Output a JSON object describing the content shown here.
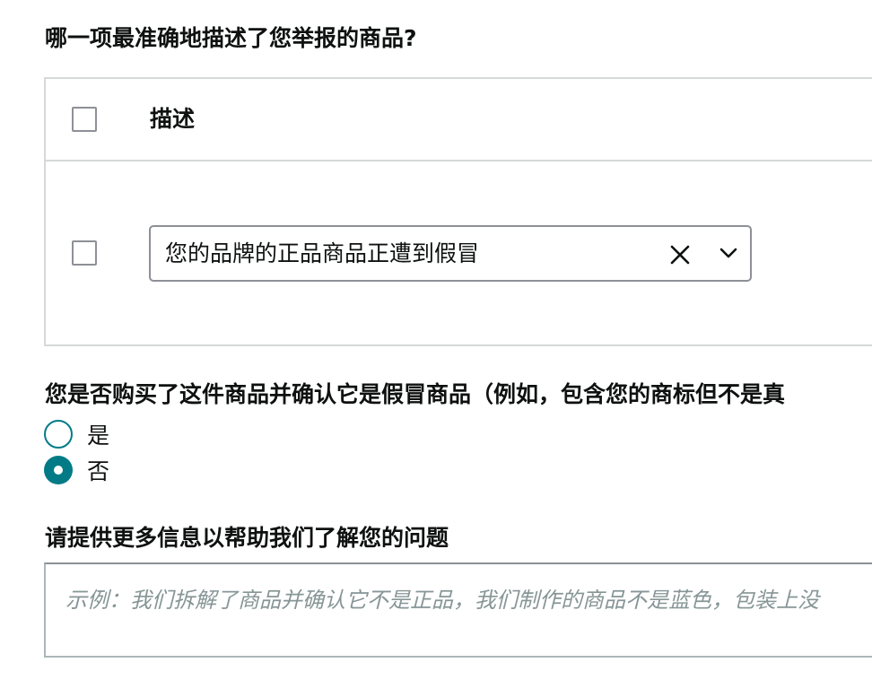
{
  "question1": {
    "title": "哪一项最准确地描述了您举报的商品?",
    "table": {
      "header_label": "描述",
      "rows": [
        {
          "selected_value": "您的品牌的正品商品正遭到假冒"
        }
      ]
    },
    "icons": {
      "clear": "close-icon",
      "expand": "chevron-down-icon"
    }
  },
  "question2": {
    "title": "您是否购买了这件商品并确认它是假冒商品（例如，包含您的商标但不是真",
    "options": [
      {
        "label": "是",
        "selected": false
      },
      {
        "label": "否",
        "selected": true
      }
    ]
  },
  "question3": {
    "title": "请提供更多信息以帮助我们了解您的问题",
    "placeholder": "示例：我们拆解了商品并确认它不是正品，我们制作的商品不是蓝色，包装上没"
  },
  "colors": {
    "accent": "#027b87",
    "border": "#d5d9d9",
    "control_border": "#8d9096",
    "placeholder": "#879596"
  }
}
